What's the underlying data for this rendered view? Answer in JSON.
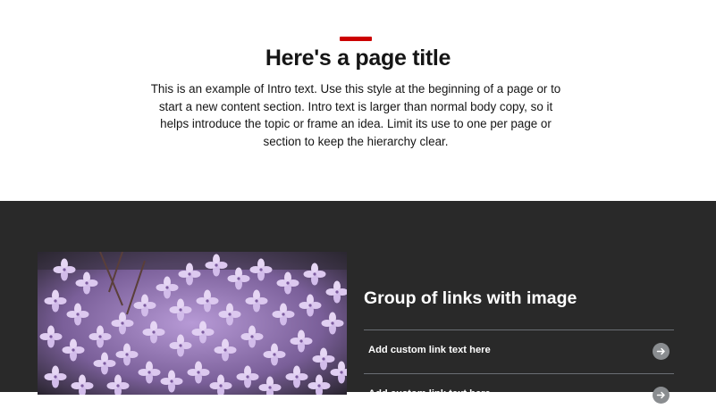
{
  "intro": {
    "title": "Here's a page title",
    "text": "This is an example of Intro text. Use this style at the beginning of a page or to start a new content section. Intro text is larger than normal body copy, so it helps introduce the topic or frame an idea. Limit its use to one per page or section to keep the hierarchy clear."
  },
  "links_section": {
    "title": "Group of links with image",
    "links": [
      {
        "label": "Add custom link text here",
        "icon": "arrow-right-icon"
      },
      {
        "label": "Add custom link text here",
        "icon": "arrow-right-icon"
      }
    ]
  },
  "colors": {
    "accent": "#cc0000",
    "dark_background": "#292929",
    "text_dark": "#151515",
    "arrow_circle": "#8a8d90"
  }
}
